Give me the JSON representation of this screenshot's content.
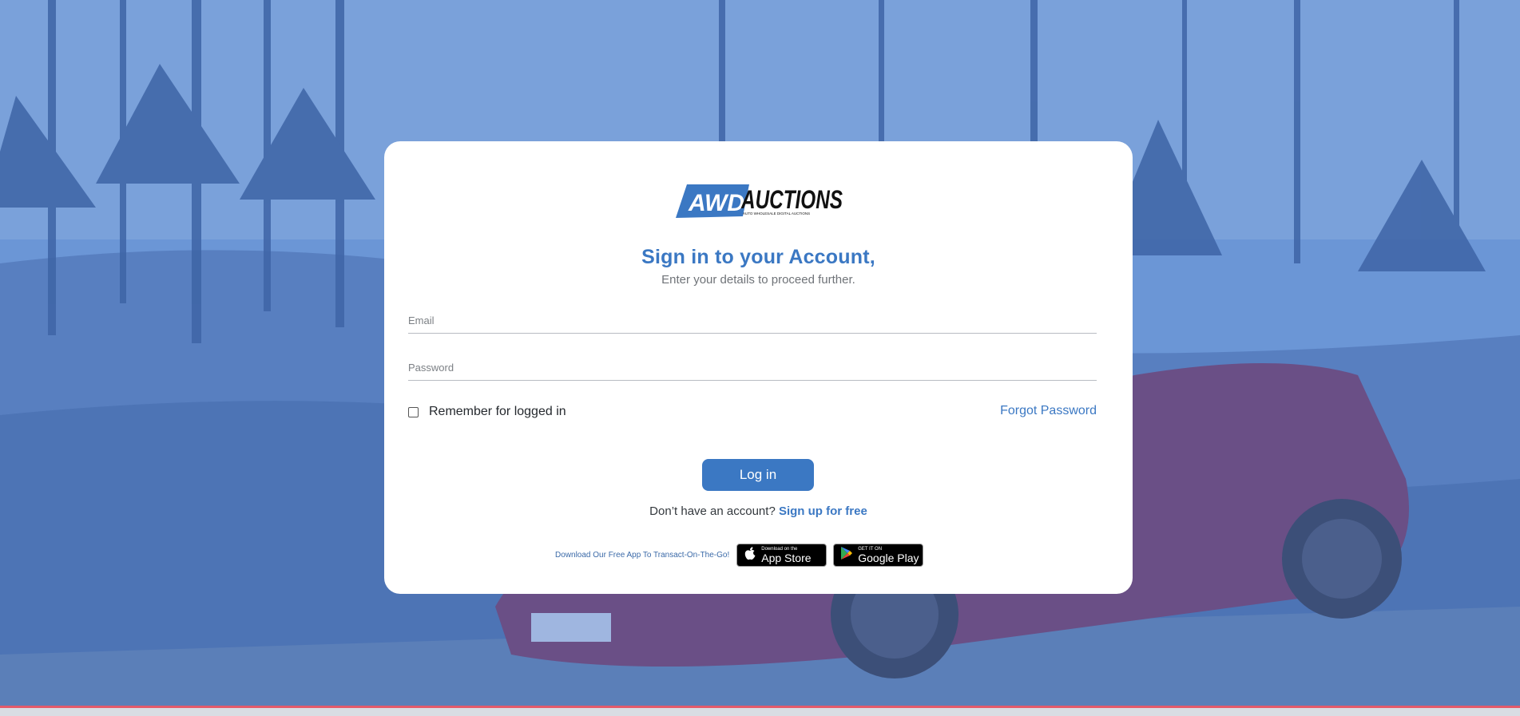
{
  "brand": {
    "logo_text_left": "AWD",
    "logo_text_right": "AUCTIONS",
    "logo_tagline": "AUTO WHOLESALE DIGITAL AUCTIONS",
    "accent_color": "#3b78c3"
  },
  "login": {
    "title": "Sign in to your Account,",
    "subtitle": "Enter your details to proceed further.",
    "email_placeholder": "Email",
    "password_placeholder": "Password",
    "remember_label": "Remember for logged in",
    "forgot_label": "Forgot Password",
    "login_button": "Log in",
    "no_account_text": "Don’t have an account?",
    "signup_link": "Sign up for free"
  },
  "download": {
    "text": "Download Our Free App To Transact-On-The-Go!",
    "app_store": {
      "small": "Download on the",
      "big": "App Store",
      "icon": "apple-icon"
    },
    "google_play": {
      "small": "GET IT ON",
      "big": "Google Play",
      "icon": "google-play-icon"
    }
  }
}
